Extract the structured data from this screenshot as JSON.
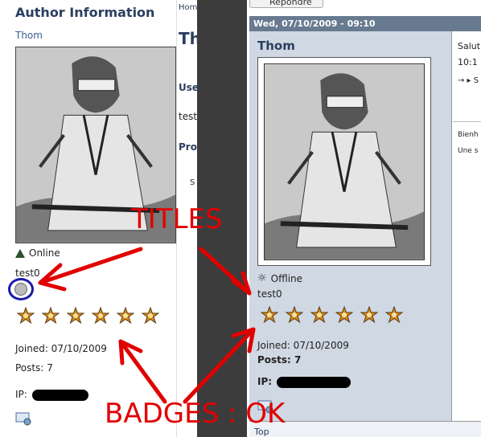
{
  "left_panel": {
    "heading": "Author Information",
    "username": "Thom",
    "status": "Online",
    "user_title": "test0",
    "joined": "Joined: 07/10/2009",
    "posts": "Posts: 7",
    "ip_label": "IP:"
  },
  "middle_fragment": {
    "breadcrumb": "Hom",
    "title": "Th",
    "user_frag": "Use",
    "test_frag": "test",
    "pro_frag": "Pro",
    "s_frag": "S"
  },
  "right_panel": {
    "reply_button": "Répondre",
    "date": "Wed, 07/10/2009 - 09:10",
    "username": "Thom",
    "status": "Offline",
    "user_title": "test0",
    "joined": "Joined: 07/10/2009",
    "posts": "Posts: 7",
    "ip_label": "IP:",
    "content_lines": [
      "Salut",
      "10:1",
      "→ ▸ S",
      "Bienh",
      "Une s"
    ],
    "top_link": "Top"
  },
  "annotations": {
    "titles": "TITLES",
    "badges": "BADGES : OK"
  },
  "colors": {
    "annotation": "#e10000",
    "header_bar": "#677a90",
    "post_bg": "#cfd8e3",
    "dark_divider": "#3c3c3c"
  },
  "badge_count": 6
}
